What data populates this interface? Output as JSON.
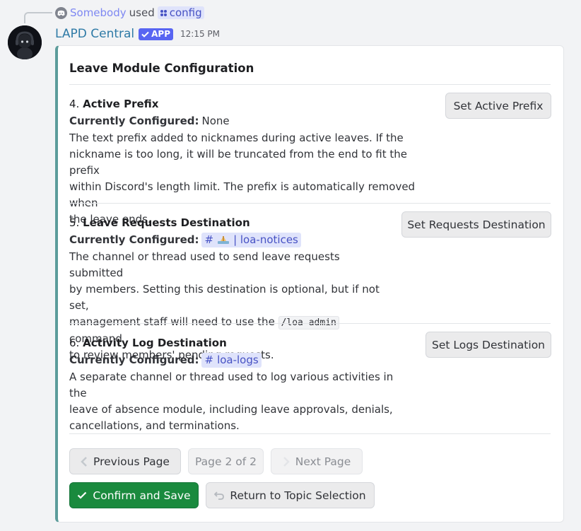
{
  "reply": {
    "user": "Somebody",
    "verb": "used",
    "command": "config"
  },
  "message": {
    "author": "LAPD Central",
    "badge": "APP",
    "time": "12:15 PM"
  },
  "embed": {
    "title": "Leave Module Configuration",
    "current_label": "Currently Configured:",
    "sections": [
      {
        "number": "4.",
        "title": "Active Prefix",
        "current": "None",
        "desc_lines": [
          "The text prefix added to nicknames during active leaves. If the",
          "nickname is too long, it will be truncated from the end to fit the prefix",
          "within Discord's length limit. The prefix is automatically removed when",
          "the leave ends."
        ],
        "button": "Set Active Prefix"
      },
      {
        "number": "5.",
        "title": "Leave Requests Destination",
        "current_hash": "#",
        "current_channel": "| loa-notices",
        "desc_lines": [
          "The channel or thread used to send leave requests submitted",
          "by members. Setting this destination is optional, but if not set,",
          "management staff will need to use the",
          "command",
          "to review members' pending requests."
        ],
        "code": "/loa admin",
        "button": "Set Requests Destination"
      },
      {
        "number": "6.",
        "title": "Activity Log Destination",
        "current_hash": "#",
        "current_channel": "loa-logs",
        "desc_lines": [
          "A separate channel or thread used to log various activities in the",
          "leave of absence module, including leave approvals, denials,",
          "cancellations, and terminations."
        ],
        "button": "Set Logs Destination"
      }
    ]
  },
  "buttons": {
    "previous": "Previous Page",
    "page_indicator": "Page 2 of 2",
    "next": "Next Page",
    "confirm": "Confirm and Save",
    "return": "Return to Topic Selection"
  },
  "colors": {
    "embed_accent": "#5c9c9b",
    "success": "#1a8a3e",
    "mention_bg": "#dfe3fb",
    "author": "#2e7aa6"
  }
}
